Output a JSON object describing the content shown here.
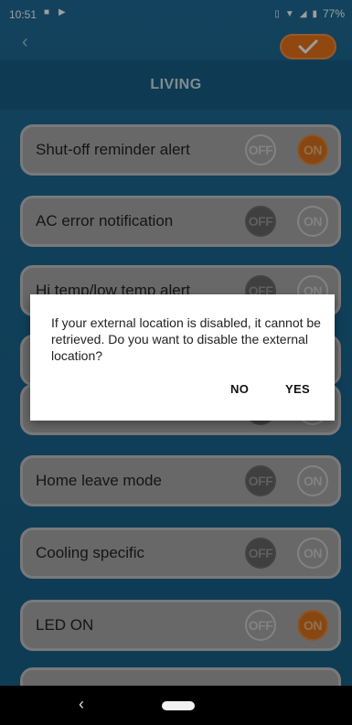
{
  "status_bar": {
    "time": "10:51",
    "battery": "77%",
    "icons": [
      "message-icon",
      "play-store-icon",
      "vibrate-icon",
      "wifi-icon",
      "signal-icon",
      "battery-icon"
    ]
  },
  "header": {
    "back_icon": "chevron-left-icon",
    "confirm_icon": "checkmark-icon",
    "accent": "#e9741a"
  },
  "title": "LIVING",
  "settings": [
    {
      "label": "Shut-off reminder alert",
      "off": "OFF",
      "on": "ON",
      "state": "on"
    },
    {
      "label": "AC error notification",
      "off": "OFF",
      "on": "ON",
      "state": "off"
    },
    {
      "label": "Hi temp/low temp alert",
      "off": "OFF",
      "on": "ON",
      "state": "off"
    },
    {
      "label": "",
      "off": "",
      "on": "",
      "state": "off"
    },
    {
      "label": "",
      "off": "",
      "on": "",
      "state": "off"
    },
    {
      "label": "Home leave mode",
      "off": "OFF",
      "on": "ON",
      "state": "off"
    },
    {
      "label": "Cooling specific",
      "off": "OFF",
      "on": "ON",
      "state": "off"
    },
    {
      "label": "LED ON",
      "off": "OFF",
      "on": "ON",
      "state": "on"
    }
  ],
  "dialog": {
    "message": "If your external location is disabled, it cannot be retrieved. Do you want to disable the external location?",
    "no_label": "NO",
    "yes_label": "YES"
  },
  "nav_bar": {
    "back_icon": "back-triangle-icon",
    "home_icon": "home-pill-icon"
  }
}
